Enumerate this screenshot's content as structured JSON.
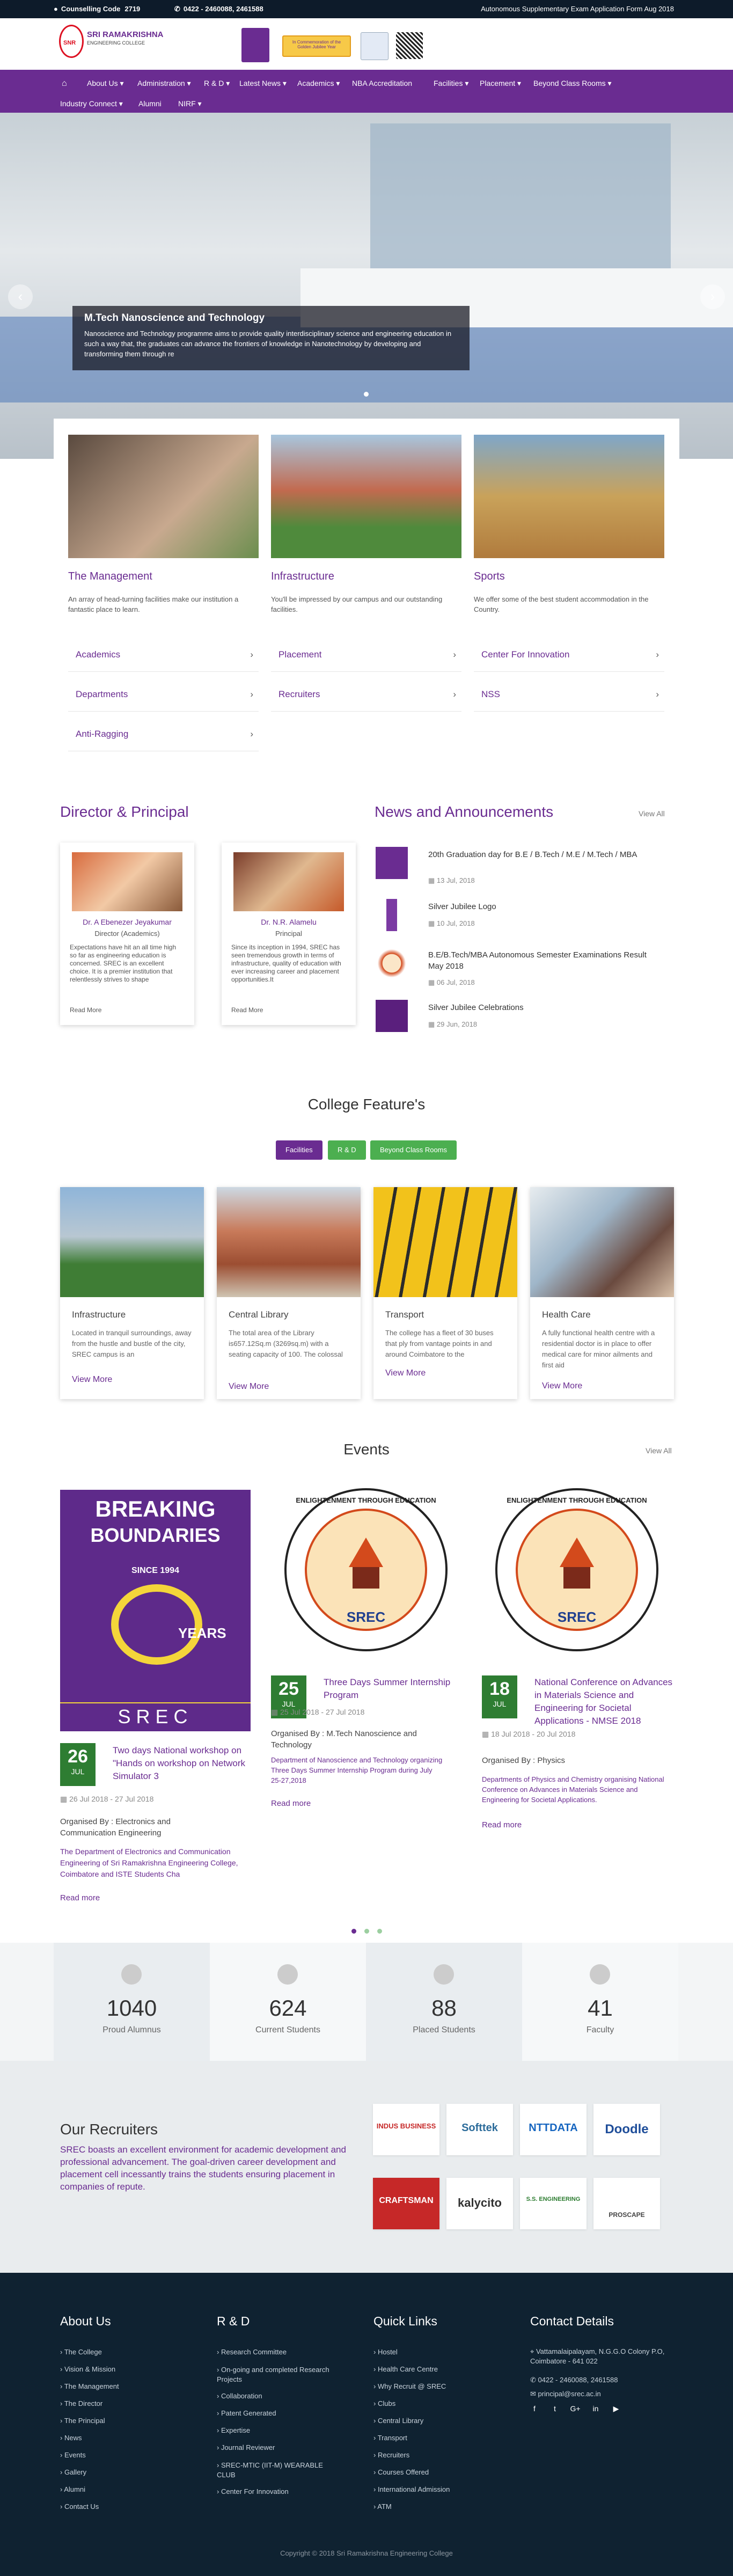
{
  "topbar": {
    "counselling_label": "Counselling Code",
    "counselling_code": "2719",
    "phone": "0422 - 2460088, 2461588",
    "notice": "Autonomous Supplementary Exam Application Form Aug 2018"
  },
  "header": {
    "college_name": "SRI RAMAKRISHNA",
    "college_sub": "ENGINEERING COLLEGE",
    "brand_short": "SNR",
    "banner_text": "In Commemoration of the Golden Jubilee Year"
  },
  "nav": {
    "items": [
      "About Us",
      "Administration",
      "R & D",
      "Latest News",
      "Academics",
      "NBA Accreditation",
      "Facilities",
      "Placement",
      "Beyond Class Rooms",
      "Industry Connect",
      "Alumni",
      "NIRF"
    ]
  },
  "hero": {
    "title": "M.Tech Nanoscience and Technology",
    "text": "Nanoscience and Technology programme aims to provide quality interdisciplinary science and engineering education in such a way that, the graduates can advance the frontiers of knowledge in Nanotechnology by developing and transforming them through re"
  },
  "cards": [
    {
      "title": "The Management",
      "text": "An array of head-turning facilities make our institution a fantastic place to learn."
    },
    {
      "title": "Infrastructure",
      "text": "You'll be impressed by our campus and our outstanding facilities."
    },
    {
      "title": "Sports",
      "text": "We offer some of the best student accommodation in the Country."
    }
  ],
  "quick_links": [
    [
      "Academics",
      "Placement",
      "Center For Innovation"
    ],
    [
      "Departments",
      "Recruiters",
      "NSS"
    ],
    [
      "Anti-Ragging"
    ]
  ],
  "director": {
    "heading": "Director & Principal",
    "people": [
      {
        "name": "Dr. A Ebenezer Jeyakumar",
        "role": "Director (Academics)",
        "text": "Expectations have hit an all time high so far as engineering education is concerned. SREC is an excellent choice. It is a premier institution that relentlessly strives to shape",
        "more": "Read More"
      },
      {
        "name": "Dr. N.R. Alamelu",
        "role": "Principal",
        "text": "Since its inception in 1994, SREC has seen tremendous growth in terms of infrastructure, quality of education with ever increasing career and placement opportunities.It",
        "more": "Read More"
      }
    ]
  },
  "news": {
    "heading": "News and Announcements",
    "view_all": "View All",
    "items": [
      {
        "title": "20th Graduation day for B.E / B.Tech / M.E / M.Tech / MBA",
        "date": "13 Jul, 2018"
      },
      {
        "title": "Silver Jubilee Logo",
        "date": "10 Jul, 2018"
      },
      {
        "title": "B.E/B.Tech/MBA Autonomous Semester Examinations Result May 2018",
        "date": "06 Jul, 2018"
      },
      {
        "title": "Silver Jubilee Celebrations",
        "date": "29 Jun, 2018"
      }
    ]
  },
  "features": {
    "heading": "College Feature's",
    "tabs": [
      "Facilities",
      "R & D",
      "Beyond Class Rooms"
    ],
    "items": [
      {
        "title": "Infrastructure",
        "text": "Located in tranquil surroundings, away from the hustle and bustle of the city, SREC campus is an",
        "more": "View More"
      },
      {
        "title": "Central Library",
        "text": "The total area of the Library is657.12Sq.m (3269sq.m) with a seating capacity of 100. The colossal",
        "more": "View More"
      },
      {
        "title": "Transport",
        "text": "The college has a fleet of 30 buses that ply from vantage points in and around Coimbatore to the",
        "more": "View More"
      },
      {
        "title": "Health Care",
        "text": "A fully functional health centre with a residential doctor is in place to offer medical care for minor ailments and first aid",
        "more": "View More"
      }
    ]
  },
  "events": {
    "heading": "Events",
    "view_all": "View All",
    "poster": {
      "line1": "BREAKING",
      "line2": "BOUNDARIES",
      "since": "SINCE 1994",
      "years": "YEARS",
      "srec": "SREC"
    },
    "seal": {
      "top": "ENLIGHTENMENT THROUGH EDUCATION",
      "bottom": "SREC"
    },
    "items": [
      {
        "day": "26",
        "month": "JUL",
        "title": "Two days National workshop on \"Hands on workshop on Network Simulator 3",
        "date": "26 Jul 2018 - 27 Jul 2018",
        "org": "Organised By : Electronics and Communication Engineering",
        "desc": "The Department of Electronics and Communication Engineering of Sri Ramakrishna Engineering College, Coimbatore and ISTE Students Cha",
        "more": "Read more"
      },
      {
        "day": "25",
        "month": "JUL",
        "title": "Three Days Summer Internship Program",
        "date": "25 Jul 2018 - 27 Jul 2018",
        "org": "Organised By : M.Tech Nanoscience and Technology",
        "desc": "Department of Nanoscience and Technology organizing Three Days Summer Internship Program during July 25-27,2018",
        "more": "Read more"
      },
      {
        "day": "18",
        "month": "JUL",
        "title": "National Conference on Advances in Materials Science and Engineering for Societal Applications - NMSE 2018",
        "date": "18 Jul 2018 - 20 Jul 2018",
        "org": "Organised By : Physics",
        "desc": "Departments of Physics and Chemistry organising National Conference on Advances in Materials Science and Engineering for Societal Applications.",
        "more": "Read more"
      }
    ]
  },
  "stats": [
    {
      "num": "1040",
      "label": "Proud Alumnus"
    },
    {
      "num": "624",
      "label": "Current Students"
    },
    {
      "num": "88",
      "label": "Placed Students"
    },
    {
      "num": "41",
      "label": "Faculty"
    }
  ],
  "recruiters": {
    "heading": "Our Recruiters",
    "text": "SREC boasts an excellent environment for academic development and professional advancement. The goal-driven career development and placement cell incessantly trains the students ensuring placement in companies of repute.",
    "logos": [
      "INDUS BUSINESS",
      "Softtek",
      "NTTDATA",
      "Doodle",
      "CRAFTSMAN",
      "kalycito",
      "S.S. ENGINEERING",
      "PROSCAPE"
    ]
  },
  "footer": {
    "about": {
      "heading": "About Us",
      "links": [
        "The College",
        "Vision & Mission",
        "The Management",
        "The Director",
        "The Principal",
        "News",
        "Events",
        "Gallery",
        "Alumni",
        "Contact Us"
      ]
    },
    "rd": {
      "heading": "R & D",
      "links": [
        "Research Committee",
        "On-going and completed Research Projects",
        "Collaboration",
        "Patent Generated",
        "Expertise",
        "Journal Reviewer",
        "SREC-MTIC (IIT-M) WEARABLE CLUB",
        "Center For Innovation"
      ]
    },
    "quick": {
      "heading": "Quick Links",
      "links": [
        "Hostel",
        "Health Care Centre",
        "Why Recruit @ SREC",
        "Clubs",
        "Central Library",
        "Transport",
        "Recruiters",
        "Courses Offered",
        "International Admission",
        "ATM"
      ]
    },
    "contact": {
      "heading": "Contact Details",
      "address": "Vattamalaipalayam, N.G.G.O Colony P.O, Coimbatore - 641 022",
      "phone": "0422 - 2460088, 2461588",
      "email": "principal@srec.ac.in"
    },
    "social": [
      "f",
      "t",
      "G+",
      "in",
      "▶"
    ],
    "copyright": "Copyright © 2018 Sri Ramakrishna Engineering College"
  },
  "colors": {
    "brand": "#6a2c91",
    "green": "#2e7d32",
    "topbar": "#0d1b2a",
    "footer": "#0f2231"
  }
}
